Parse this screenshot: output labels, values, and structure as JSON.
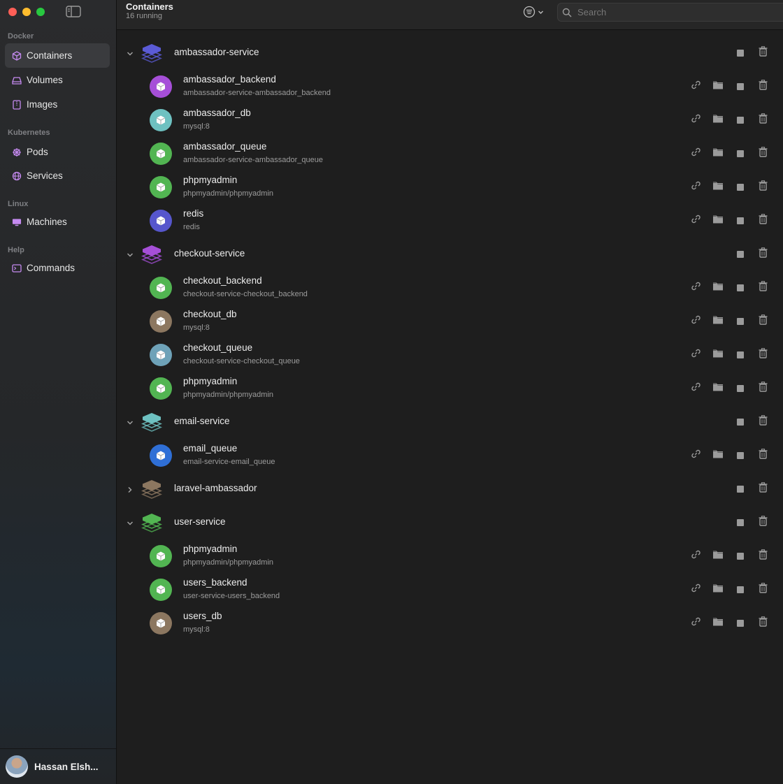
{
  "sidebar": {
    "sections": [
      {
        "label": "Docker",
        "items": [
          {
            "label": "Containers",
            "icon": "box-icon",
            "active": true
          },
          {
            "label": "Volumes",
            "icon": "drive-icon"
          },
          {
            "label": "Images",
            "icon": "archive-icon"
          }
        ]
      },
      {
        "label": "Kubernetes",
        "items": [
          {
            "label": "Pods",
            "icon": "helm-icon"
          },
          {
            "label": "Services",
            "icon": "network-icon"
          }
        ]
      },
      {
        "label": "Linux",
        "items": [
          {
            "label": "Machines",
            "icon": "monitor-icon"
          }
        ]
      },
      {
        "label": "Help",
        "items": [
          {
            "label": "Commands",
            "icon": "terminal-icon"
          }
        ]
      }
    ],
    "user": {
      "name": "Hassan Elsh..."
    }
  },
  "header": {
    "title": "Containers",
    "subtitle": "16 running",
    "search_placeholder": "Search"
  },
  "colors": {
    "accent_purple": "#b26ad9",
    "green": "#5cb85c",
    "teal": "#6bbfbf",
    "indigo": "#5a5ad0",
    "brown": "#8c7760",
    "steel": "#6e9fb5",
    "blue": "#2f6fd6"
  },
  "groups": [
    {
      "name": "ambassador-service",
      "expanded": true,
      "stack_color": "#5b5bd6",
      "containers": [
        {
          "name": "ambassador_backend",
          "image": "ambassador-service-ambassador_backend",
          "color": "#a64fd8"
        },
        {
          "name": "ambassador_db",
          "image": "mysql:8",
          "color": "#6ec1c1"
        },
        {
          "name": "ambassador_queue",
          "image": "ambassador-service-ambassador_queue",
          "color": "#52b552"
        },
        {
          "name": "phpmyadmin",
          "image": "phpmyadmin/phpmyadmin",
          "color": "#52b552"
        },
        {
          "name": "redis",
          "image": "redis",
          "color": "#5656cc"
        }
      ]
    },
    {
      "name": "checkout-service",
      "expanded": true,
      "stack_color": "#a64fd8",
      "containers": [
        {
          "name": "checkout_backend",
          "image": "checkout-service-checkout_backend",
          "color": "#52b552"
        },
        {
          "name": "checkout_db",
          "image": "mysql:8",
          "color": "#8c7760"
        },
        {
          "name": "checkout_queue",
          "image": "checkout-service-checkout_queue",
          "color": "#6ea2b8"
        },
        {
          "name": "phpmyadmin",
          "image": "phpmyadmin/phpmyadmin",
          "color": "#52b552"
        }
      ]
    },
    {
      "name": "email-service",
      "expanded": true,
      "stack_color": "#6ec1c1",
      "containers": [
        {
          "name": "email_queue",
          "image": "email-service-email_queue",
          "color": "#2f6fd6"
        }
      ]
    },
    {
      "name": "laravel-ambassador",
      "expanded": false,
      "stack_color": "#8c7760",
      "containers": []
    },
    {
      "name": "user-service",
      "expanded": true,
      "stack_color": "#52b552",
      "containers": [
        {
          "name": "phpmyadmin",
          "image": "phpmyadmin/phpmyadmin",
          "color": "#52b552"
        },
        {
          "name": "users_backend",
          "image": "user-service-users_backend",
          "color": "#52b552"
        },
        {
          "name": "users_db",
          "image": "mysql:8",
          "color": "#8c7760"
        }
      ]
    }
  ]
}
